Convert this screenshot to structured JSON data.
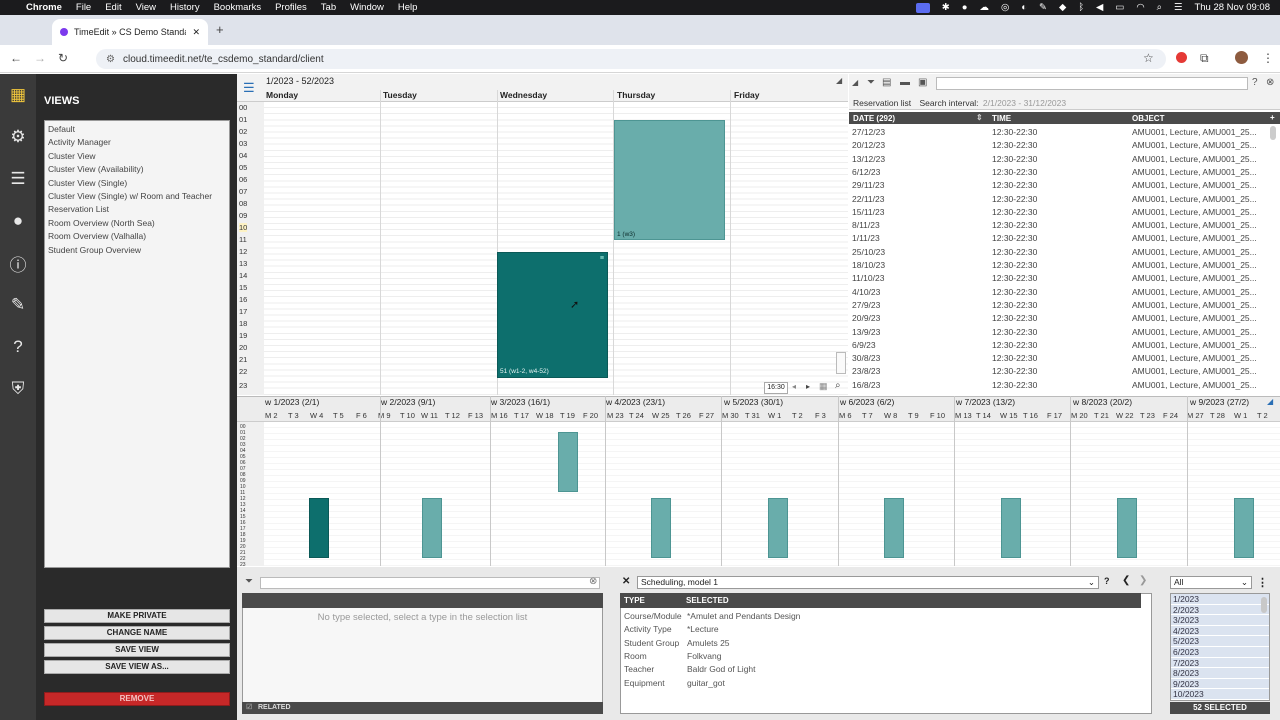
{
  "menubar": {
    "app": "Chrome",
    "items": [
      "File",
      "Edit",
      "View",
      "History",
      "Bookmarks",
      "Profiles",
      "Tab",
      "Window",
      "Help"
    ],
    "clock": "Thu 28 Nov 09:08"
  },
  "browser": {
    "tab_title": "TimeEdit » CS Demo Standard",
    "url": "cloud.timeedit.net/te_csdemo_standard/client",
    "new_tab": "+"
  },
  "views": {
    "title": "VIEWS",
    "items": [
      "Default",
      "Activity Manager",
      "Cluster View",
      "Cluster View (Availability)",
      "Cluster View (Single)",
      "Cluster View (Single) w/ Room and Teacher",
      "Reservation List",
      "Room Overview (North Sea)",
      "Room Overview (Valhalla)",
      "Student Group Overview"
    ],
    "buttons": {
      "make_private": "MAKE PRIVATE",
      "change_name": "CHANGE NAME",
      "save_view": "SAVE VIEW",
      "save_view_as": "SAVE VIEW AS...",
      "remove": "REMOVE"
    }
  },
  "calendar": {
    "range": "1/2023 - 52/2023",
    "days": [
      "Monday",
      "Tuesday",
      "Wednesday",
      "Thursday",
      "Friday"
    ],
    "hours": [
      "00",
      "01",
      "02",
      "03",
      "04",
      "05",
      "06",
      "07",
      "08",
      "09",
      "10",
      "11",
      "12",
      "13",
      "14",
      "15",
      "16",
      "17",
      "18",
      "19",
      "20",
      "21",
      "22",
      "23"
    ],
    "res_thursday_label": "1 (w3)",
    "res_wednesday_label": "51 (w1-2, w4-52)",
    "time_chip": "16:30"
  },
  "reservation_list": {
    "title": "Reservation list",
    "interval_label": "Search interval:",
    "interval": "2/1/2023 - 31/12/2023",
    "col_date": "DATE (292)",
    "col_time": "TIME",
    "col_object": "OBJECT",
    "rows": [
      {
        "date": "27/12/23",
        "time": "12:30-22:30",
        "object": "AMU001, Lecture, AMU001_25..."
      },
      {
        "date": "20/12/23",
        "time": "12:30-22:30",
        "object": "AMU001, Lecture, AMU001_25..."
      },
      {
        "date": "13/12/23",
        "time": "12:30-22:30",
        "object": "AMU001, Lecture, AMU001_25..."
      },
      {
        "date": "6/12/23",
        "time": "12:30-22:30",
        "object": "AMU001, Lecture, AMU001_25..."
      },
      {
        "date": "29/11/23",
        "time": "12:30-22:30",
        "object": "AMU001, Lecture, AMU001_25..."
      },
      {
        "date": "22/11/23",
        "time": "12:30-22:30",
        "object": "AMU001, Lecture, AMU001_25..."
      },
      {
        "date": "15/11/23",
        "time": "12:30-22:30",
        "object": "AMU001, Lecture, AMU001_25..."
      },
      {
        "date": "8/11/23",
        "time": "12:30-22:30",
        "object": "AMU001, Lecture, AMU001_25..."
      },
      {
        "date": "1/11/23",
        "time": "12:30-22:30",
        "object": "AMU001, Lecture, AMU001_25..."
      },
      {
        "date": "25/10/23",
        "time": "12:30-22:30",
        "object": "AMU001, Lecture, AMU001_25..."
      },
      {
        "date": "18/10/23",
        "time": "12:30-22:30",
        "object": "AMU001, Lecture, AMU001_25..."
      },
      {
        "date": "11/10/23",
        "time": "12:30-22:30",
        "object": "AMU001, Lecture, AMU001_25..."
      },
      {
        "date": "4/10/23",
        "time": "12:30-22:30",
        "object": "AMU001, Lecture, AMU001_25..."
      },
      {
        "date": "27/9/23",
        "time": "12:30-22:30",
        "object": "AMU001, Lecture, AMU001_25..."
      },
      {
        "date": "20/9/23",
        "time": "12:30-22:30",
        "object": "AMU001, Lecture, AMU001_25..."
      },
      {
        "date": "13/9/23",
        "time": "12:30-22:30",
        "object": "AMU001, Lecture, AMU001_25..."
      },
      {
        "date": "6/9/23",
        "time": "12:30-22:30",
        "object": "AMU001, Lecture, AMU001_25..."
      },
      {
        "date": "30/8/23",
        "time": "12:30-22:30",
        "object": "AMU001, Lecture, AMU001_25..."
      },
      {
        "date": "23/8/23",
        "time": "12:30-22:30",
        "object": "AMU001, Lecture, AMU001_25..."
      },
      {
        "date": "16/8/23",
        "time": "12:30-22:30",
        "object": "AMU001, Lecture, AMU001_25..."
      }
    ]
  },
  "strip": {
    "weeks": [
      "w 1/2023 (2/1)",
      "w 2/2023 (9/1)",
      "w 3/2023 (16/1)",
      "w 4/2023 (23/1)",
      "w 5/2023 (30/1)",
      "w 6/2023 (6/2)",
      "w 7/2023 (13/2)",
      "w 8/2023 (20/2)",
      "w 9/2023 (27/2)"
    ],
    "days": [
      "M 2",
      "T 3",
      "W 4",
      "T 5",
      "F 6",
      "M 9",
      "T 10",
      "W 11",
      "T 12",
      "F 13",
      "M 16",
      "T 17",
      "W 18",
      "T 19",
      "F 20",
      "M 23",
      "T 24",
      "W 25",
      "T 26",
      "F 27",
      "M 30",
      "T 31",
      "W 1",
      "T 2",
      "F 3",
      "M 6",
      "T 7",
      "W 8",
      "T 9",
      "F 10",
      "M 13",
      "T 14",
      "W 15",
      "T 16",
      "F 17",
      "M 20",
      "T 21",
      "W 22",
      "T 23",
      "F 24",
      "M 27",
      "T 28",
      "W 1",
      "T 2"
    ],
    "hours": [
      "00",
      "01",
      "02",
      "03",
      "04",
      "05",
      "06",
      "07",
      "08",
      "09",
      "10",
      "11",
      "12",
      "13",
      "14",
      "15",
      "16",
      "17",
      "18",
      "19",
      "20",
      "21",
      "22",
      "23"
    ]
  },
  "selection": {
    "placeholder": "No type selected, select a type in the selection list",
    "related": "RELATED"
  },
  "scheduling": {
    "model": "Scheduling, model 1",
    "col_type": "TYPE",
    "col_selected": "SELECTED",
    "rows": [
      {
        "type": "Course/Module",
        "value": "*Amulet and Pendants Design"
      },
      {
        "type": "Activity Type",
        "value": "*Lecture"
      },
      {
        "type": "Student Group",
        "value": "Amulets 25"
      },
      {
        "type": "Room",
        "value": "Folkvang"
      },
      {
        "type": "Teacher",
        "value": "Baldr God of Light"
      },
      {
        "type": "Equipment",
        "value": "guitar_got"
      }
    ]
  },
  "weeks_panel": {
    "filter": "All",
    "items": [
      "1/2023",
      "2/2023",
      "3/2023",
      "4/2023",
      "5/2023",
      "6/2023",
      "7/2023",
      "8/2023",
      "9/2023",
      "10/2023"
    ],
    "count": "52 SELECTED"
  },
  "colors": {
    "light_res": "#69adab",
    "dark_res": "#0d6f6d",
    "remove": "#c62828",
    "active_icon": "#f3c83c"
  }
}
